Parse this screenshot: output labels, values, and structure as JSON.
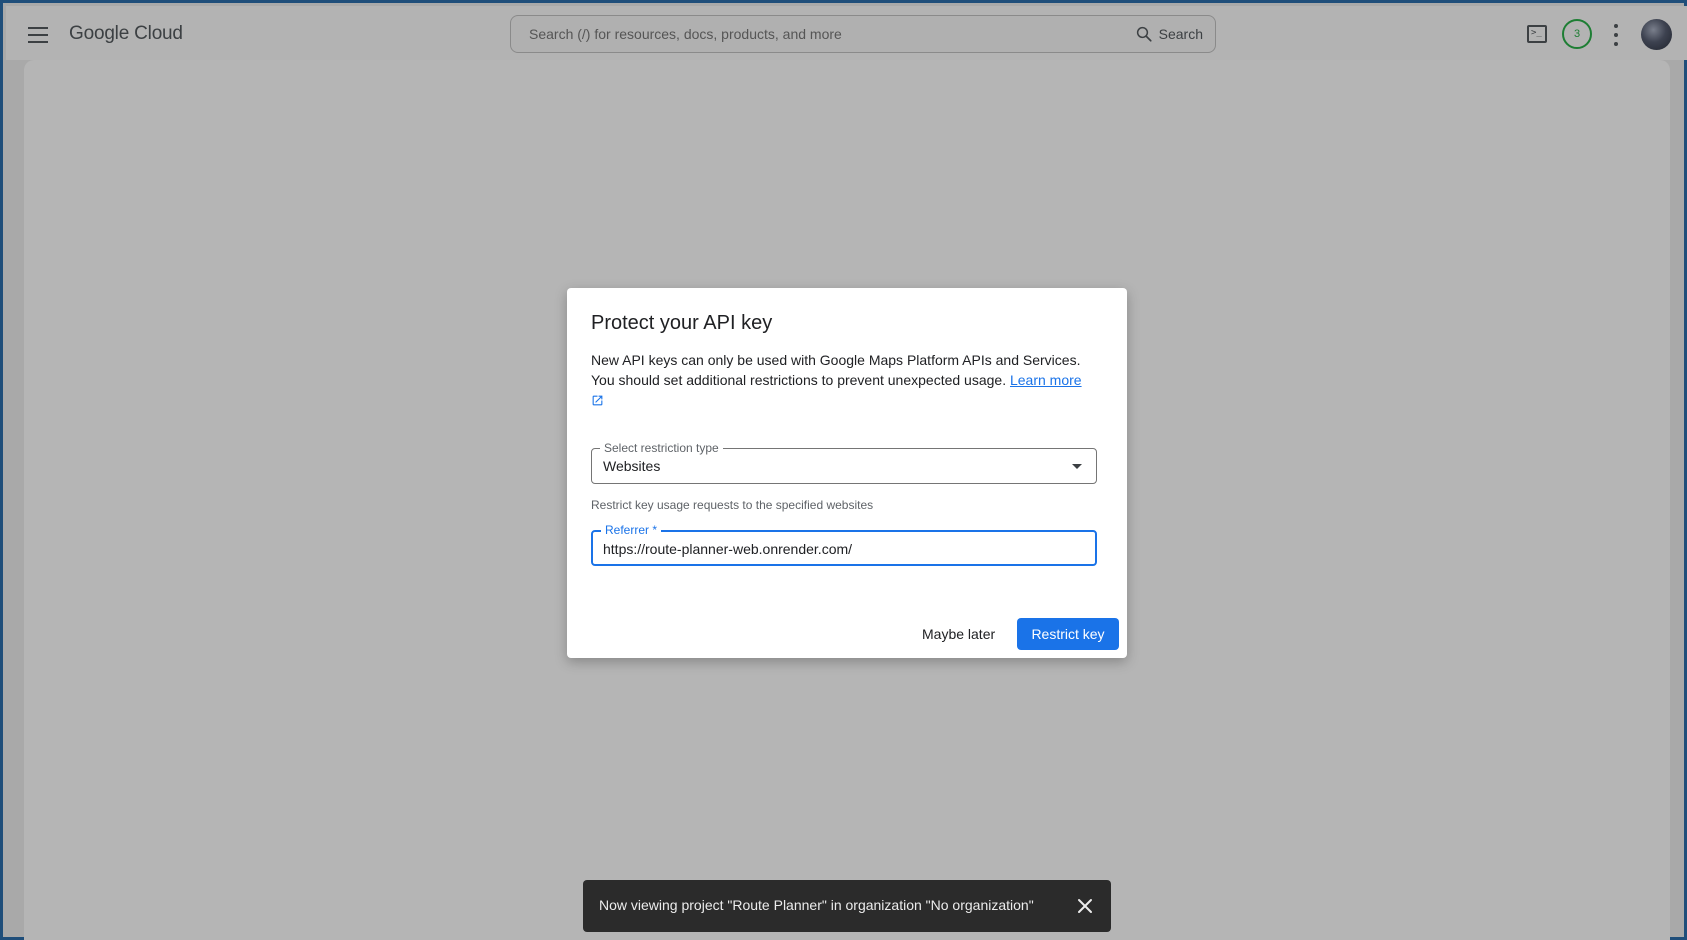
{
  "app": {
    "logo_text": "Google Cloud"
  },
  "header": {
    "search_placeholder": "Search (/) for resources, docs, products, and more",
    "search_button_label": "Search",
    "notification_count": "3"
  },
  "dialog": {
    "title": "Protect your API key",
    "description": "New API keys can only be used with Google Maps Platform APIs and Services. You should set additional restrictions to prevent unexpected usage.",
    "learn_more_label": "Learn more",
    "restriction_type_label": "Select restriction type",
    "restriction_type_value": "Websites",
    "hint": "Restrict key usage requests to the specified websites",
    "referrer_label": "Referrer *",
    "referrer_value": "https://route-planner-web.onrender.com/",
    "maybe_later_label": "Maybe later",
    "restrict_key_label": "Restrict key"
  },
  "snackbar": {
    "message": "Now viewing project \"Route Planner\" in organization \"No organization\""
  },
  "colors": {
    "accent": "#1a73e8",
    "badge": "#1e7e34",
    "snackbar_bg": "#2b2b2b"
  }
}
